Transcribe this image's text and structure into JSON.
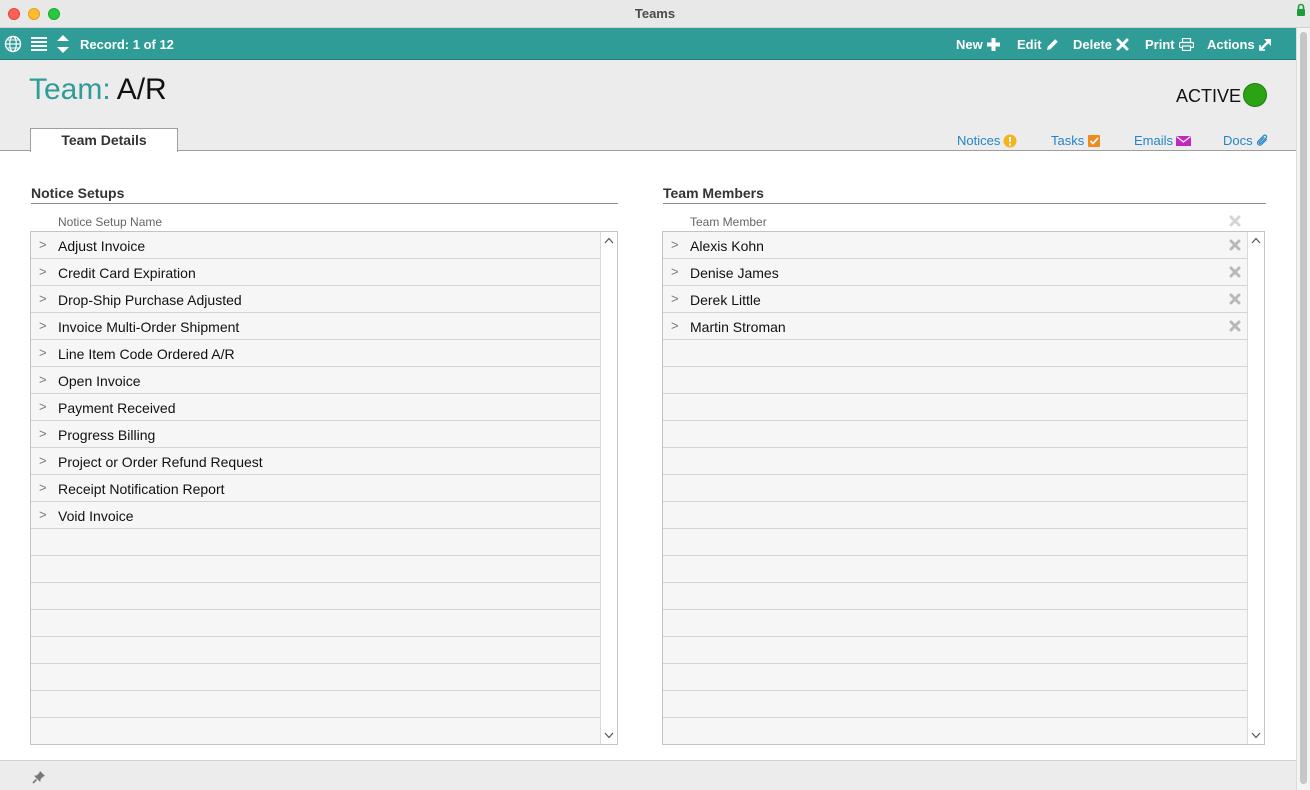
{
  "window": {
    "title": "Teams"
  },
  "toolbar": {
    "record_label": "Record: 1 of 12",
    "new_label": "New",
    "edit_label": "Edit",
    "delete_label": "Delete",
    "print_label": "Print",
    "actions_label": "Actions"
  },
  "header": {
    "title_label": "Team:",
    "title_value": "A/R",
    "status": "ACTIVE",
    "status_color": "#2ca313"
  },
  "tabs": [
    {
      "label": "Team Details"
    }
  ],
  "side_links": {
    "notices": "Notices",
    "tasks": "Tasks",
    "emails": "Emails",
    "docs": "Docs"
  },
  "notice_setups": {
    "title": "Notice Setups",
    "column": "Notice Setup Name",
    "items": [
      "Adjust Invoice",
      "Credit Card Expiration",
      "Drop-Ship Purchase Adjusted",
      "Invoice Multi-Order Shipment",
      "Line Item Code Ordered A/R",
      "Open Invoice",
      "Payment Received",
      "Progress Billing",
      "Project or Order Refund Request",
      "Receipt Notification Report",
      "Void Invoice"
    ]
  },
  "team_members": {
    "title": "Team Members",
    "column": "Team Member",
    "items": [
      "Alexis Kohn",
      "Denise James",
      "Derek Little",
      "Martin Stroman"
    ]
  },
  "colors": {
    "accent": "#2f9c97",
    "link": "#2485c7",
    "notices_icon": "#f2b51b",
    "tasks_icon": "#ef8a1f",
    "emails_icon": "#c327c0"
  }
}
